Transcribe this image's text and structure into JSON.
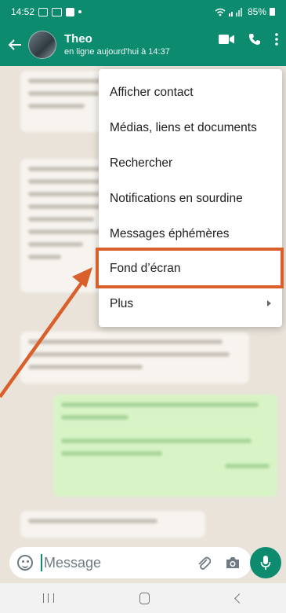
{
  "status_bar": {
    "time": "14:52",
    "battery": "85%"
  },
  "header": {
    "contact_name": "Theo",
    "contact_status": "en ligne aujourd'hui à 14:37"
  },
  "menu": {
    "items": [
      {
        "label": "Afficher contact"
      },
      {
        "label": "Médias, liens et documents"
      },
      {
        "label": "Rechercher"
      },
      {
        "label": "Notifications en sourdine"
      },
      {
        "label": "Messages éphémères"
      },
      {
        "label": "Fond d’écran"
      },
      {
        "label": "Plus"
      }
    ],
    "highlighted_item": "Fond d’écran"
  },
  "composer": {
    "placeholder": "Message"
  },
  "colors": {
    "brand": "#0c8b6f",
    "highlight": "#d9602a"
  }
}
